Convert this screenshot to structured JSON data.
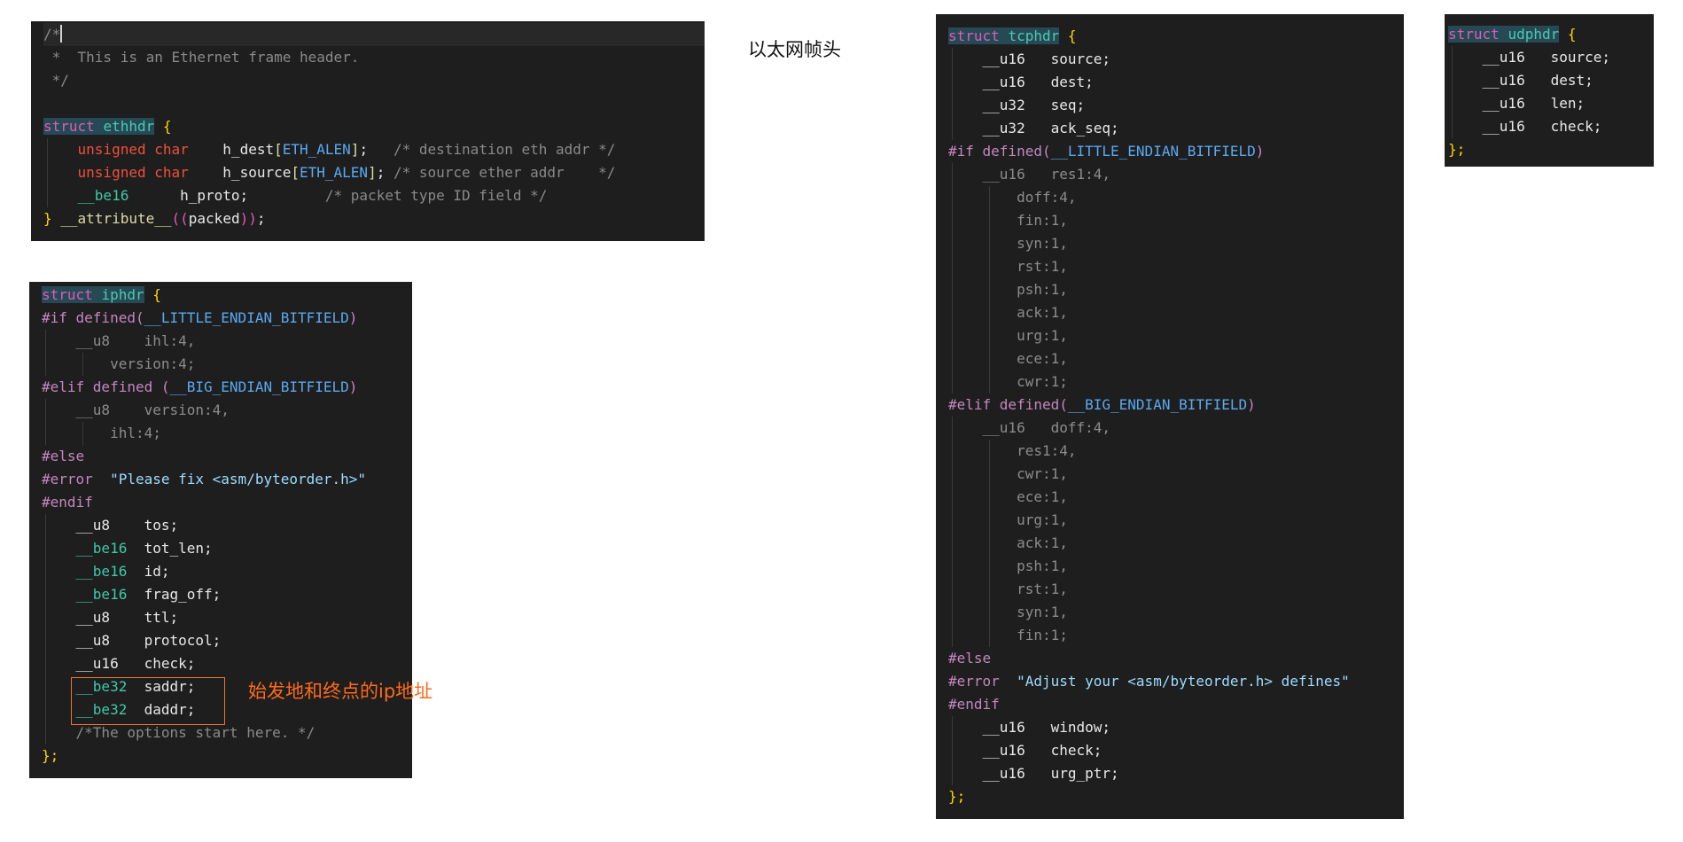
{
  "caption_ethernet": "以太网帧头",
  "annotation_ip": "始发地和终点的ip地址",
  "eth": {
    "comment_open": "/*",
    "comment_line": " *  This is an Ethernet frame header.",
    "comment_close": " */",
    "kw_struct": "struct",
    "name": "ethhdr",
    "brace_open": " {",
    "f1_type": "unsigned char",
    "f1_name": "h_dest",
    "f1_len": "ETH_ALEN",
    "f1_comment": "/* destination eth addr */",
    "f2_type": "unsigned char",
    "f2_name": "h_source",
    "f2_len": "ETH_ALEN",
    "f2_comment": "/* source ether addr    */",
    "f3_type": "__be16",
    "f3_name": "h_proto;",
    "f3_comment": "/* packet type ID field */",
    "close_brace": "}",
    "attr": "__attribute__",
    "packed": "packed"
  },
  "ip": {
    "kw_struct": "struct",
    "name": "iphdr",
    "if_little": "#if defined(",
    "little_macro": "__LITTLE_ENDIAN_BITFIELD",
    "lines_little": [
      "__u8    ihl:4,",
      "version:4;"
    ],
    "elif_big": "#elif defined (",
    "big_macro": "__BIG_ENDIAN_BITFIELD",
    "lines_big": [
      "__u8    version:4,",
      "ihl:4;"
    ],
    "else": "#else",
    "error_kw": "#error",
    "error_msg": "\"Please fix <asm/byteorder.h>\"",
    "endif": "#endif",
    "fields": [
      {
        "type": "__u8",
        "name": "tos;"
      },
      {
        "type": "__be16",
        "name": "tot_len;"
      },
      {
        "type": "__be16",
        "name": "id;"
      },
      {
        "type": "__be16",
        "name": "frag_off;"
      },
      {
        "type": "__u8",
        "name": "ttl;"
      },
      {
        "type": "__u8",
        "name": "protocol;"
      },
      {
        "type": "__u16",
        "name": "check;"
      },
      {
        "type": "__be32",
        "name": "saddr;"
      },
      {
        "type": "__be32",
        "name": "daddr;"
      }
    ],
    "options_comment": "/*The options start here. */",
    "close": "};"
  },
  "tcp": {
    "kw_struct": "struct",
    "name": "tcphdr",
    "fields_top": [
      {
        "type": "__u16",
        "name": "source;"
      },
      {
        "type": "__u16",
        "name": "dest;"
      },
      {
        "type": "__u32",
        "name": "seq;"
      },
      {
        "type": "__u32",
        "name": "ack_seq;"
      }
    ],
    "if_little": "#if defined(",
    "little_macro": "__LITTLE_ENDIAN_BITFIELD",
    "little_first": "__u16   res1:4,",
    "little_bits": [
      "doff:4,",
      "fin:1,",
      "syn:1,",
      "rst:1,",
      "psh:1,",
      "ack:1,",
      "urg:1,",
      "ece:1,",
      "cwr:1;"
    ],
    "elif_big": "#elif defined(",
    "big_macro": "__BIG_ENDIAN_BITFIELD",
    "big_first": "__u16   doff:4,",
    "big_bits": [
      "res1:4,",
      "cwr:1,",
      "ece:1,",
      "urg:1,",
      "ack:1,",
      "psh:1,",
      "rst:1,",
      "syn:1,",
      "fin:1;"
    ],
    "else": "#else",
    "error_kw": "#error",
    "error_msg": "\"Adjust your <asm/byteorder.h> defines\"",
    "endif": "#endif",
    "fields_bottom": [
      {
        "type": "__u16",
        "name": "window;"
      },
      {
        "type": "__u16",
        "name": "check;"
      },
      {
        "type": "__u16",
        "name": "urg_ptr;"
      }
    ],
    "close": "};"
  },
  "udp": {
    "kw_struct": "struct",
    "name": "udphdr",
    "fields": [
      {
        "type": "__u16",
        "name": "source;"
      },
      {
        "type": "__u16",
        "name": "dest;"
      },
      {
        "type": "__u16",
        "name": "len;"
      },
      {
        "type": "__u16",
        "name": "check;"
      }
    ],
    "close": "};"
  }
}
